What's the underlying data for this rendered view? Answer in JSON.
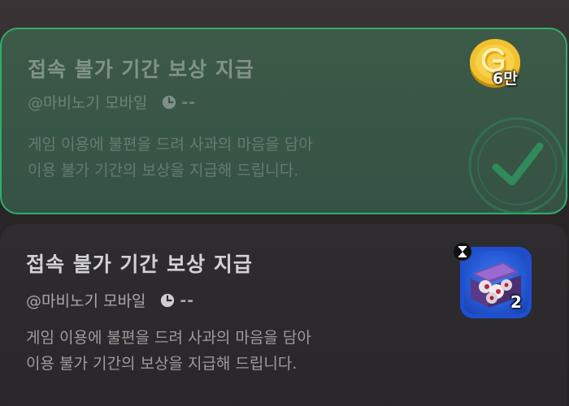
{
  "cards": [
    {
      "state": "claimed",
      "title": "접속 불가 기간 보상 지급",
      "sender": "@마비노기 모바일",
      "time": "--",
      "description_line1": "게임 이용에 불편을 드려 사과의 마음을 담아",
      "description_line2": "이용 불가 기간의 보상을 지급해 드립니다.",
      "reward": {
        "icon": "gold-coin-icon",
        "count": "6만"
      }
    },
    {
      "state": "pending",
      "title": "접속 불가 기간 보상 지급",
      "sender": "@마비노기 모바일",
      "time": "--",
      "description_line1": "게임 이용에 불편을 드려 사과의 마음을 담아",
      "description_line2": "이용 불가 기간의 보상을 지급해 드립니다.",
      "reward": {
        "icon": "gift-box-item-icon",
        "count": "2"
      }
    }
  ],
  "colors": {
    "claimed_border": "#2fae6c",
    "claimed_background": "#3d5a48",
    "pending_background": "#2f2c30",
    "item_frame": "#1d4fd0",
    "coin_gold": "#f2c12e"
  }
}
